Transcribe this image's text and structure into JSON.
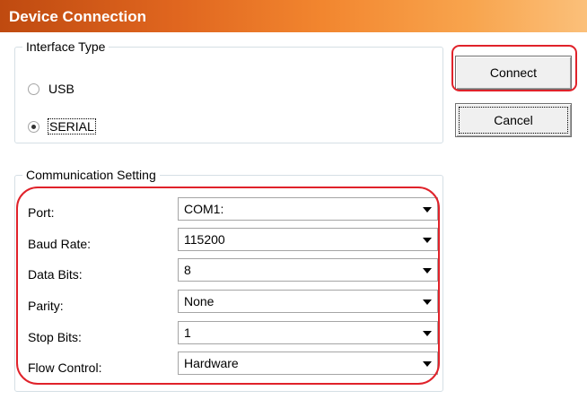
{
  "window": {
    "title": "Device Connection"
  },
  "interface_type": {
    "legend": "Interface Type",
    "options": [
      {
        "label": "USB",
        "checked": false
      },
      {
        "label": "SERIAL",
        "checked": true
      }
    ]
  },
  "buttons": {
    "connect": "Connect",
    "cancel": "Cancel"
  },
  "communication": {
    "legend": "Communication Setting",
    "fields": [
      {
        "label": "Port:",
        "value": "COM1:"
      },
      {
        "label": "Baud Rate:",
        "value": "115200"
      },
      {
        "label": "Data Bits:",
        "value": "8"
      },
      {
        "label": "Parity:",
        "value": "None"
      },
      {
        "label": "Stop Bits:",
        "value": "1"
      },
      {
        "label": "Flow Control:",
        "value": "Hardware"
      }
    ]
  },
  "colors": {
    "highlight": "#e0222a",
    "title_gradient_start": "#bf4a10",
    "title_gradient_end": "#fbc07a"
  },
  "icons": {
    "dropdown": "chevron-down-icon",
    "radio": "radio-button-icon"
  }
}
